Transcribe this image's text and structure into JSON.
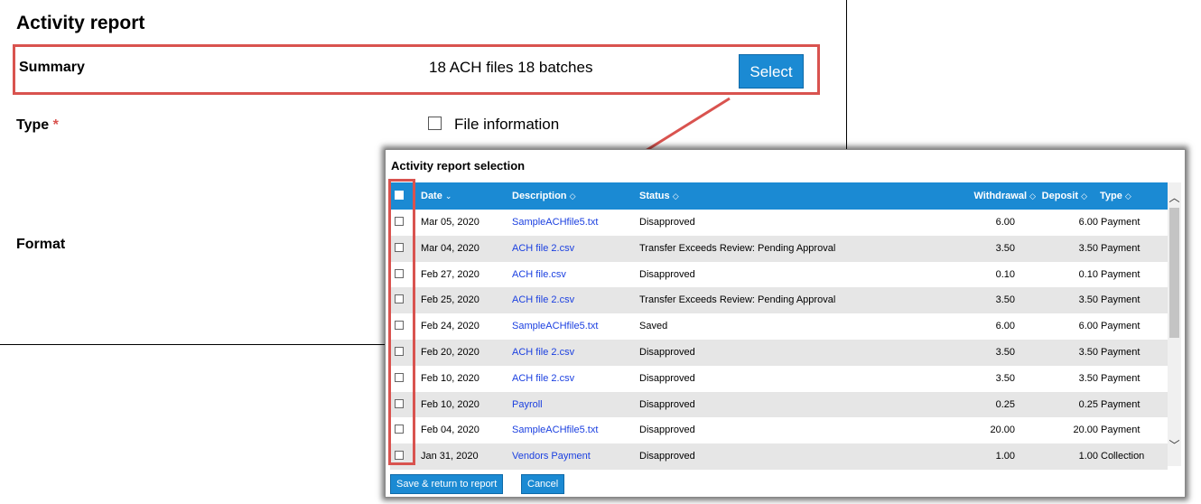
{
  "form": {
    "title": "Activity report",
    "summary_label": "Summary",
    "summary_value": "18 ACH files 18 batches",
    "select_label": "Select",
    "type_label": "Type",
    "required_mark": "*",
    "file_info_label": "File information",
    "format_label": "Format"
  },
  "popup": {
    "title": "Activity report selection",
    "headers": {
      "date": "Date",
      "description": "Description",
      "status": "Status",
      "withdrawal": "Withdrawal",
      "deposit": "Deposit",
      "type": "Type"
    },
    "rows": [
      {
        "date": "Mar 05, 2020",
        "description": "SampleACHfile5.txt",
        "status": "Disapproved",
        "withdrawal": "6.00",
        "deposit": "6.00",
        "type": "Payment"
      },
      {
        "date": "Mar 04, 2020",
        "description": "ACH file 2.csv",
        "status": "Transfer Exceeds Review: Pending Approval",
        "withdrawal": "3.50",
        "deposit": "3.50",
        "type": "Payment"
      },
      {
        "date": "Feb 27, 2020",
        "description": "ACH file.csv",
        "status": "Disapproved",
        "withdrawal": "0.10",
        "deposit": "0.10",
        "type": "Payment"
      },
      {
        "date": "Feb 25, 2020",
        "description": "ACH file 2.csv",
        "status": "Transfer Exceeds Review: Pending Approval",
        "withdrawal": "3.50",
        "deposit": "3.50",
        "type": "Payment"
      },
      {
        "date": "Feb 24, 2020",
        "description": "SampleACHfile5.txt",
        "status": "Saved",
        "withdrawal": "6.00",
        "deposit": "6.00",
        "type": "Payment"
      },
      {
        "date": "Feb 20, 2020",
        "description": "ACH file 2.csv",
        "status": "Disapproved",
        "withdrawal": "3.50",
        "deposit": "3.50",
        "type": "Payment"
      },
      {
        "date": "Feb 10, 2020",
        "description": "ACH file 2.csv",
        "status": "Disapproved",
        "withdrawal": "3.50",
        "deposit": "3.50",
        "type": "Payment"
      },
      {
        "date": "Feb 10, 2020",
        "description": "Payroll",
        "status": "Disapproved",
        "withdrawal": "0.25",
        "deposit": "0.25",
        "type": "Payment"
      },
      {
        "date": "Feb 04, 2020",
        "description": "SampleACHfile5.txt",
        "status": "Disapproved",
        "withdrawal": "20.00",
        "deposit": "20.00",
        "type": "Payment"
      },
      {
        "date": "Jan 31, 2020",
        "description": "Vendors Payment",
        "status": "Disapproved",
        "withdrawal": "1.00",
        "deposit": "1.00",
        "type": "Collection"
      }
    ],
    "save_label": "Save & return to report",
    "cancel_label": "Cancel"
  },
  "colors": {
    "accent": "#1b8ad3",
    "highlight": "#d9534f",
    "link": "#1a3fe0",
    "row_alt": "#e6e6e6"
  }
}
